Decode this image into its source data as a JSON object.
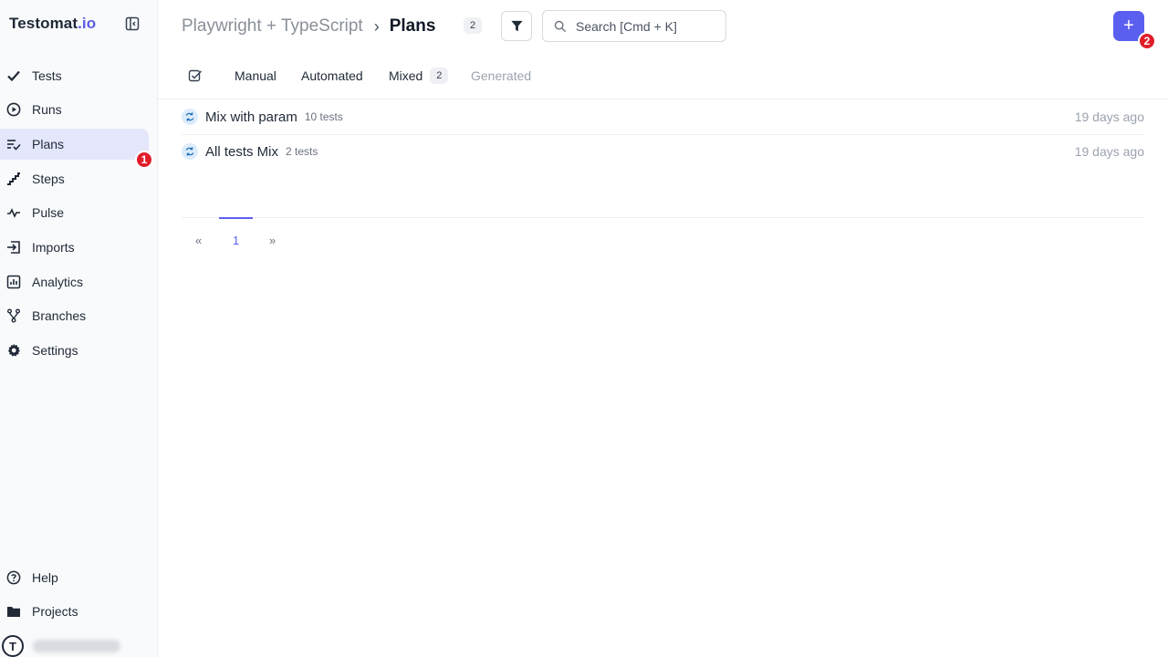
{
  "app": {
    "logo_main": "Testomat",
    "logo_suffix": ".io"
  },
  "sidebar": {
    "items": [
      {
        "label": "Tests",
        "icon": "check-icon"
      },
      {
        "label": "Runs",
        "icon": "play-circle-icon"
      },
      {
        "label": "Plans",
        "icon": "list-check-icon",
        "active": true
      },
      {
        "label": "Steps",
        "icon": "stairs-icon"
      },
      {
        "label": "Pulse",
        "icon": "pulse-icon"
      },
      {
        "label": "Imports",
        "icon": "import-icon"
      },
      {
        "label": "Analytics",
        "icon": "analytics-icon"
      },
      {
        "label": "Branches",
        "icon": "branch-icon"
      },
      {
        "label": "Settings",
        "icon": "gear-icon"
      }
    ],
    "bottom": [
      {
        "label": "Help",
        "icon": "help-circle-icon"
      },
      {
        "label": "Projects",
        "icon": "folder-icon"
      }
    ],
    "plans_badge": "1",
    "avatar_letter": "T"
  },
  "header": {
    "project": "Playwright + TypeScript",
    "separator": "›",
    "current": "Plans",
    "count": "2",
    "search_placeholder": "Search [Cmd + K]",
    "add_label": "+",
    "add_badge": "2"
  },
  "tabs": [
    {
      "label": "Manual"
    },
    {
      "label": "Automated"
    },
    {
      "label": "Mixed",
      "count": "2"
    },
    {
      "label": "Generated",
      "disabled": true
    }
  ],
  "plans": [
    {
      "title": "Mix with param",
      "count": "10 tests",
      "date": "19 days ago"
    },
    {
      "title": "All tests Mix",
      "count": "2 tests",
      "date": "19 days ago"
    }
  ],
  "pagination": {
    "prev": "«",
    "current": "1",
    "next": "»"
  },
  "colors": {
    "accent": "#5b5ff0",
    "badge_red": "#e11d2a",
    "active_bg": "#e4e7fb"
  }
}
